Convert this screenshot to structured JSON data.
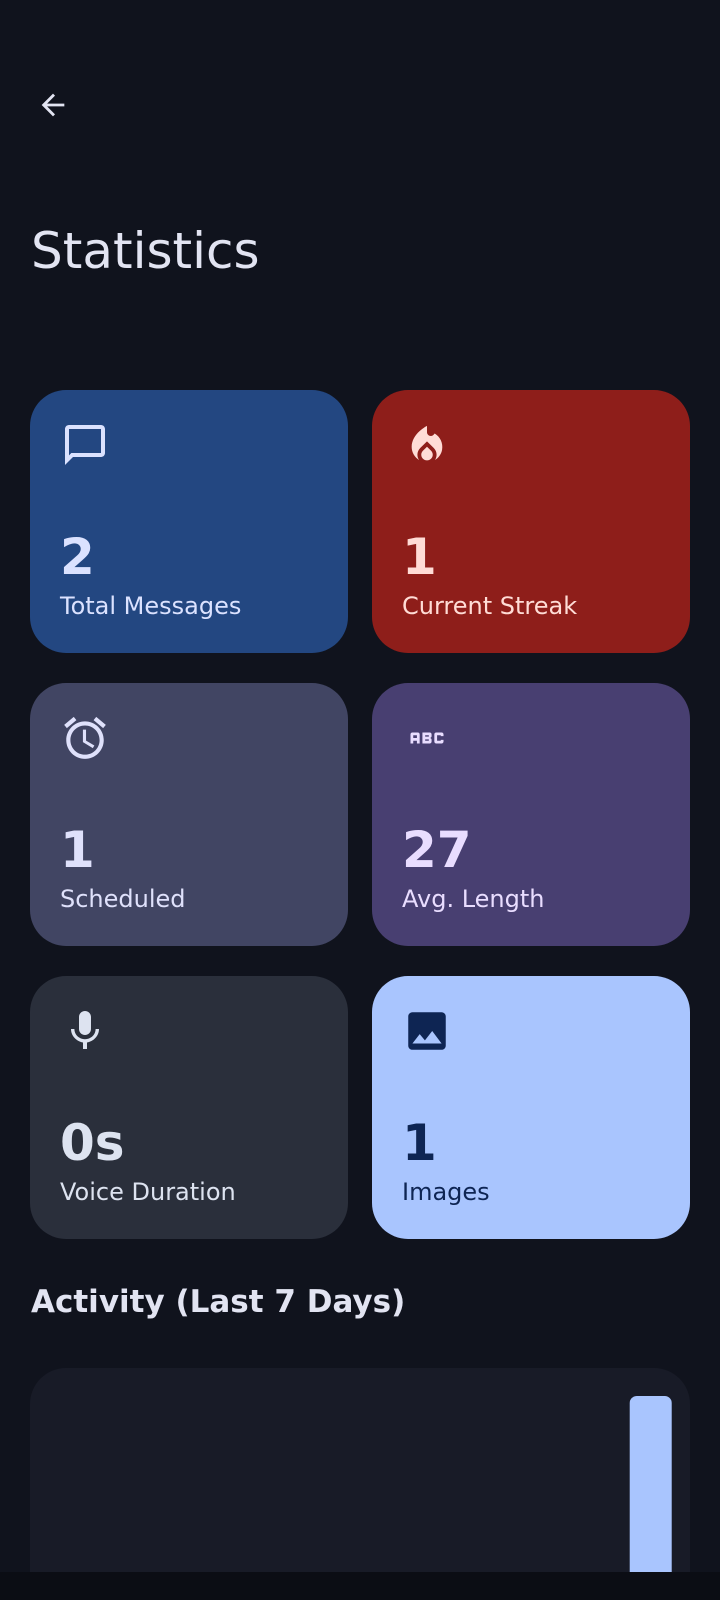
{
  "header": {
    "title": "Statistics"
  },
  "cards": [
    {
      "key": "messages",
      "value": "2",
      "label": "Total Messages",
      "icon": "chat-bubble-icon",
      "bg": "#234781",
      "fg": "#dbe2ff",
      "icon_color": "#dbe2ff"
    },
    {
      "key": "streak",
      "value": "1",
      "label": "Current Streak",
      "icon": "fire-icon",
      "bg": "#8e1e1a",
      "fg": "#ffdcd6",
      "icon_color": "#ffdcd6"
    },
    {
      "key": "scheduled",
      "value": "1",
      "label": "Scheduled",
      "icon": "alarm-clock-icon",
      "bg": "#414563",
      "fg": "#dfe1fb",
      "icon_color": "#dfe1fb"
    },
    {
      "key": "avg",
      "value": "27",
      "label": "Avg. Length",
      "icon": "abc-text-icon",
      "bg": "#483f71",
      "fg": "#e9ddff",
      "icon_color": "#e9ddff"
    },
    {
      "key": "voice",
      "value": "0s",
      "label": "Voice Duration",
      "icon": "microphone-icon",
      "bg": "#2a2f3b",
      "fg": "#dde3f0",
      "icon_color": "#dde3f0"
    },
    {
      "key": "images",
      "value": "1",
      "label": "Images",
      "icon": "image-icon",
      "bg": "#a9c5fe",
      "fg": "#0e2553",
      "icon_color": "#0e2553"
    }
  ],
  "activity": {
    "title": "Activity (Last 7 Days)"
  },
  "chart_data": {
    "type": "bar",
    "categories": [
      "",
      "",
      "",
      "",
      "",
      "",
      ""
    ],
    "values": [
      0,
      0,
      0,
      0,
      0,
      0,
      2
    ],
    "ylim": [
      0,
      2
    ],
    "grid": false,
    "bar_color": "#a9c5fe"
  },
  "colors": {
    "background": "#10131d",
    "chart_card": "#181b27",
    "text": "#e2e4f2"
  }
}
